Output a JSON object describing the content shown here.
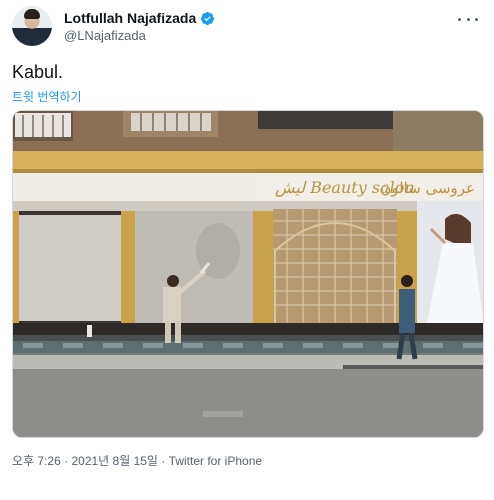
{
  "author": {
    "display_name": "Lotfullah Najafizada",
    "handle": "@LNajafizada"
  },
  "tweet": {
    "text": "Kabul.",
    "translate_label": "트윗 번역하기"
  },
  "photo": {
    "sign_left_text": "ليش Beauty salon",
    "sign_right_text": "عروسی سالون"
  },
  "timestamp": {
    "time": "오후 7:26",
    "separator": "·",
    "date": "2021년 8월 15일",
    "source": "Twitter for iPhone"
  },
  "colors": {
    "accent": "#1d9bf0",
    "secondary_text": "#536471"
  }
}
